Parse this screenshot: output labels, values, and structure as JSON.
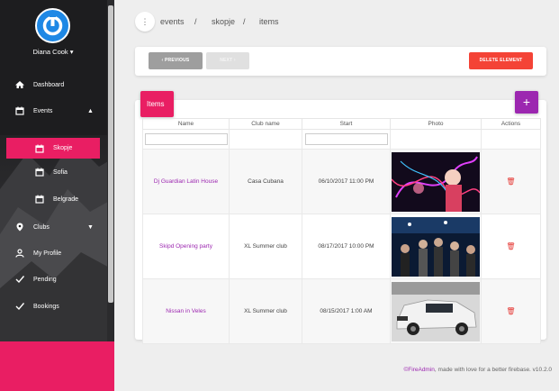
{
  "user": {
    "name": "Diana Cook"
  },
  "sidebar": {
    "items": [
      {
        "label": "Dashboard",
        "icon": "home-icon"
      },
      {
        "label": "Events",
        "icon": "calendar-icon",
        "caret": "▲"
      },
      {
        "label": "Skopje",
        "icon": "calendar-icon"
      },
      {
        "label": "Sofia",
        "icon": "calendar-icon"
      },
      {
        "label": "Belgrade",
        "icon": "calendar-icon"
      },
      {
        "label": "Clubs",
        "icon": "map-marker-icon",
        "caret": "▼"
      },
      {
        "label": "My Profile",
        "icon": "person-icon"
      },
      {
        "label": "Pending",
        "icon": "check-icon"
      },
      {
        "label": "Bookings",
        "icon": "check-icon"
      }
    ]
  },
  "breadcrumb": {
    "dot": "⋮",
    "items": [
      "events",
      "skopje",
      "items"
    ],
    "separator": "/"
  },
  "toolbar": {
    "prev_label": "‹ PREVIOUS",
    "next_label": "NEXT ›",
    "delete_label": "DELETE ELEMENT"
  },
  "list": {
    "title": "Items",
    "add_label": "+",
    "columns": [
      "Name",
      "Club name",
      "Start",
      "Photo",
      "Actions"
    ],
    "rows": [
      {
        "name": "Dj Guardian Latin House",
        "club": "Casa Cubana",
        "start": "06/10/2017 11:00 PM"
      },
      {
        "name": "Skipd Opening party",
        "club": "XL Summer club",
        "start": "08/17/2017 10:00 PM"
      },
      {
        "name": "Nissan in Veles",
        "club": "XL Summer club",
        "start": "08/15/2017 1:00 AM"
      }
    ]
  },
  "footer": {
    "brand": "©FireAdmin",
    "text": ", made with love for a better firebase. v10.2.0"
  },
  "colors": {
    "accent": "#e91e63",
    "purple": "#9c27b0",
    "danger": "#f44336",
    "sidebar_bg": "#1d1d1f"
  }
}
